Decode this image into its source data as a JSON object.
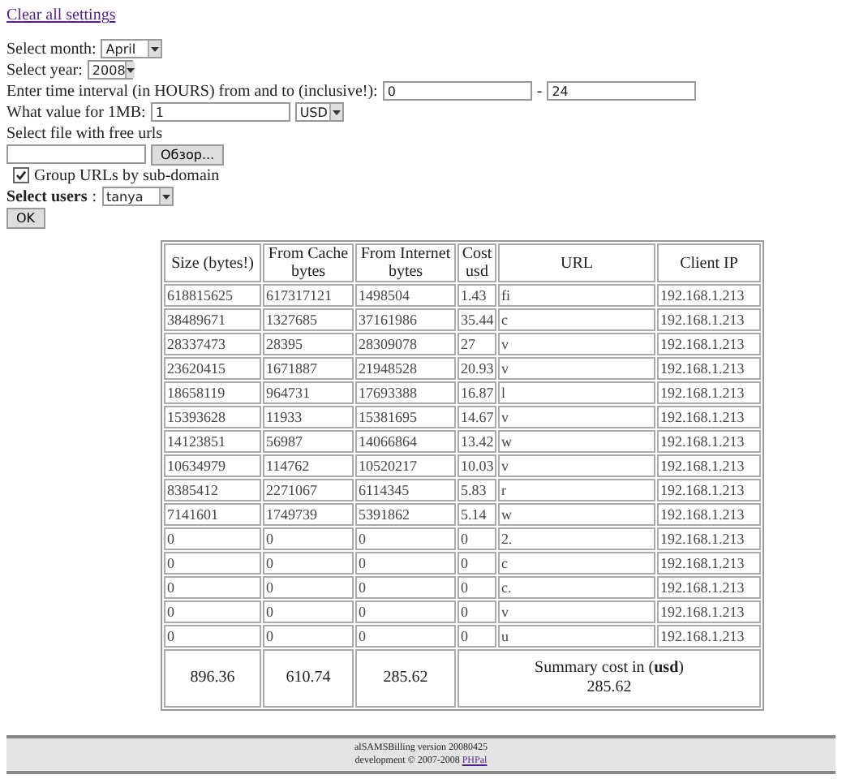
{
  "clear_link": "Clear all settings",
  "form": {
    "month_label": "Select month:",
    "month": "April",
    "year_label": "Select year:",
    "year": "2008",
    "interval_label": "Enter time interval (in HOURS) from and to (inclusive!):",
    "interval_from": "0",
    "interval_sep": "-",
    "interval_to": "24",
    "value_label": "What value for 1MB:",
    "value": "1",
    "currency": "USD",
    "file_label": "Select file with free urls",
    "browse": "Обзор...",
    "group_label": "Group URLs by sub-domain",
    "group_checked": true,
    "users_label": "Select users",
    "users_colon": ":",
    "user": "tanya",
    "ok": "OK"
  },
  "table": {
    "columns": [
      "Size (bytes!)",
      "From Cache bytes",
      "From Internet bytes",
      "Cost usd",
      "URL",
      "Client IP"
    ],
    "rows": [
      [
        "618815625",
        "617317121",
        "1498504",
        "1.43",
        "fi",
        "192.168.1.213"
      ],
      [
        "38489671",
        "1327685",
        "37161986",
        "35.44",
        "c",
        "192.168.1.213"
      ],
      [
        "28337473",
        "28395",
        "28309078",
        "27",
        "v",
        "192.168.1.213"
      ],
      [
        "23620415",
        "1671887",
        "21948528",
        "20.93",
        "v",
        "192.168.1.213"
      ],
      [
        "18658119",
        "964731",
        "17693388",
        "16.87",
        "l",
        "192.168.1.213"
      ],
      [
        "15393628",
        "11933",
        "15381695",
        "14.67",
        "v",
        "192.168.1.213"
      ],
      [
        "14123851",
        "56987",
        "14066864",
        "13.42",
        "w",
        "192.168.1.213"
      ],
      [
        "10634979",
        "114762",
        "10520217",
        "10.03",
        "v",
        "192.168.1.213"
      ],
      [
        "8385412",
        "2271067",
        "6114345",
        "5.83",
        "r",
        "192.168.1.213"
      ],
      [
        "7141601",
        "1749739",
        "5391862",
        "5.14",
        "w",
        "192.168.1.213"
      ],
      [
        "0",
        "0",
        "0",
        "0",
        "2.",
        "192.168.1.213"
      ],
      [
        "0",
        "0",
        "0",
        "0",
        "c",
        "192.168.1.213"
      ],
      [
        "0",
        "0",
        "0",
        "0",
        "c.",
        "192.168.1.213"
      ],
      [
        "0",
        "0",
        "0",
        "0",
        "v",
        "192.168.1.213"
      ],
      [
        "0",
        "0",
        "0",
        "0",
        "u",
        "192.168.1.213"
      ]
    ],
    "summary": {
      "size": "896.36",
      "cache": "610.74",
      "internet": "285.62",
      "cost_label": "Summary cost in (**usd**)",
      "cost": "285.62"
    }
  },
  "footer": {
    "line1": "alSAMSBilling version 20080425",
    "line2": "development © 2007-2008",
    "link": "PHPal"
  }
}
